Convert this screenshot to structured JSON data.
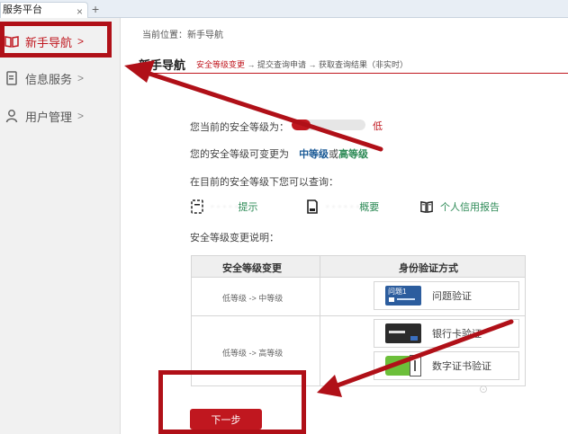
{
  "browser": {
    "tab_title": "服务平台",
    "tab_close": "×",
    "tab_new": "+"
  },
  "sidebar": {
    "items": [
      {
        "label": "新手导航",
        "arrow": ">",
        "icon": "book-icon",
        "active": true
      },
      {
        "label": "信息服务",
        "arrow": ">",
        "icon": "document-icon",
        "active": false
      },
      {
        "label": "用户管理",
        "arrow": ">",
        "icon": "user-icon",
        "active": false
      }
    ]
  },
  "breadcrumb": "当前位置：新手导航",
  "header": {
    "title": "新手导航",
    "steps_current": "安全等级变更",
    "steps_rest": "→ 提交查询申请 → 获取查询结果（非实时）"
  },
  "security": {
    "current_label": "您当前的安全等级为：",
    "level_fraction": 0.25,
    "current_level": "低",
    "change_prefix": "您的安全等级可变更为",
    "change_medium": "中等级",
    "change_or": "或",
    "change_high": "高等级",
    "query_label": "在目前的安全等级下您可以查询：",
    "services": [
      {
        "icon": "id-card-icon",
        "prefix": "· · · · ·",
        "label": "提示"
      },
      {
        "icon": "report-icon",
        "prefix": "· · · · · ·",
        "label": "概要"
      },
      {
        "icon": "open-book-icon",
        "prefix": "",
        "label": "个人信用报告"
      }
    ],
    "explain_label": "安全等级变更说明："
  },
  "table": {
    "col_change": "安全等级变更",
    "col_method": "身份验证方式",
    "rows": [
      {
        "change": "低等级 -> 中等级"
      },
      {
        "change": "低等级 -> 高等级"
      }
    ],
    "methods": [
      {
        "label": "问题验证",
        "icon": "question-card-icon",
        "icon_text": "问题1"
      },
      {
        "label": "银行卡验证",
        "icon": "bank-card-icon"
      },
      {
        "label": "数字证书验证",
        "icon": "usb-key-icon"
      }
    ]
  },
  "next_button": "下一步",
  "colors": {
    "brand_red": "#c0171f",
    "link_blue": "#1b5a96",
    "link_green": "#2e8b57"
  }
}
